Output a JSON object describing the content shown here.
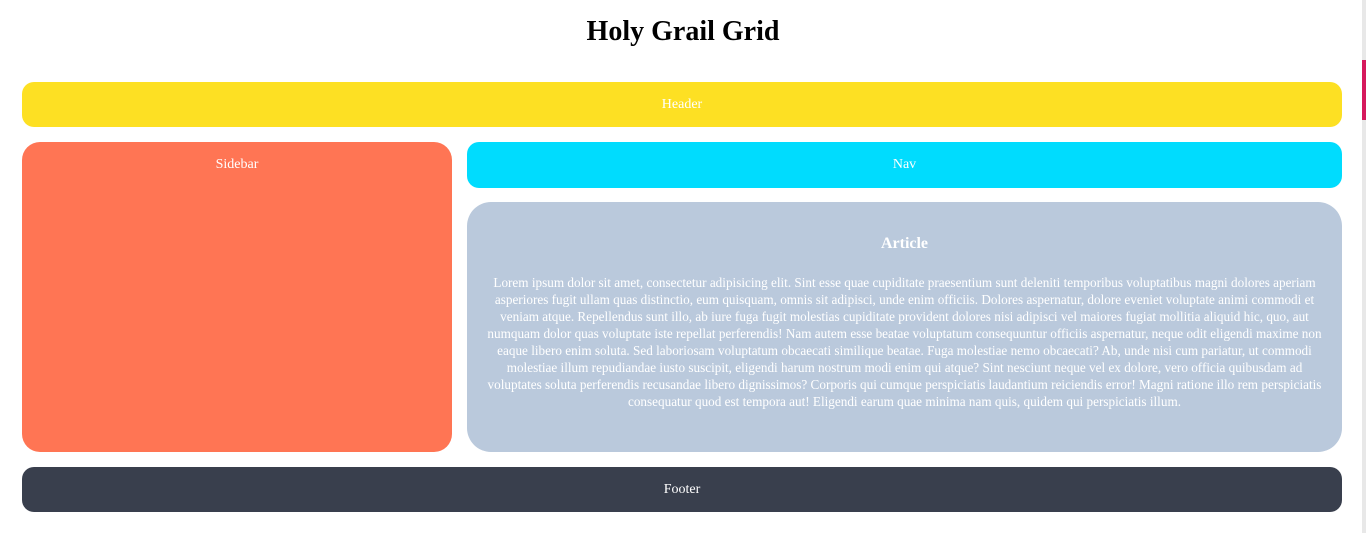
{
  "page": {
    "title": "Holy Grail Grid"
  },
  "header": {
    "label": "Header"
  },
  "sidebar": {
    "label": "Sidebar"
  },
  "nav": {
    "label": "Nav"
  },
  "article": {
    "title": "Article",
    "body": "Lorem ipsum dolor sit amet, consectetur adipisicing elit. Sint esse quae cupiditate praesentium sunt deleniti temporibus voluptatibus magni dolores aperiam asperiores fugit ullam quas distinctio, eum quisquam, omnis sit adipisci, unde enim officiis. Dolores aspernatur, dolore eveniet voluptate animi commodi et veniam atque. Repellendus sunt illo, ab iure fuga fugit molestias cupiditate provident dolores nisi adipisci vel maiores fugiat mollitia aliquid hic, quo, aut numquam dolor quas voluptate iste repellat perferendis! Nam autem esse beatae voluptatum consequuntur officiis aspernatur, neque odit eligendi maxime non eaque libero enim soluta. Sed laboriosam voluptatum obcaecati similique beatae. Fuga molestiae nemo obcaecati? Ab, unde nisi cum pariatur, ut commodi molestiae illum repudiandae iusto suscipit, eligendi harum nostrum modi enim qui atque? Sint nesciunt neque vel ex dolore, vero officia quibusdam ad voluptates soluta perferendis recusandae libero dignissimos? Corporis qui cumque perspiciatis laudantium reiciendis error! Magni ratione illo rem perspiciatis consequatur quod est tempora aut! Eligendi earum quae minima nam quis, quidem qui perspiciatis illum."
  },
  "footer": {
    "label": "Footer"
  },
  "colors": {
    "header": "#fde023",
    "sidebar": "#ff7554",
    "nav": "#00dcfe",
    "article": "#bac9dc",
    "footer": "#393f4d"
  }
}
